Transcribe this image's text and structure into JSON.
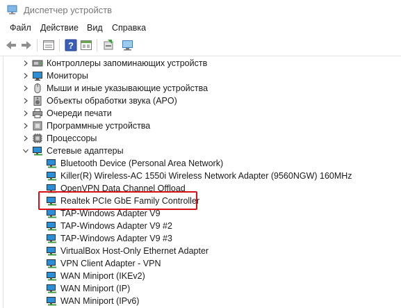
{
  "window": {
    "title": "Диспетчер устройств"
  },
  "menu": [
    {
      "label": "Файл"
    },
    {
      "label": "Действие"
    },
    {
      "label": "Вид"
    },
    {
      "label": "Справка"
    }
  ],
  "toolbar": {
    "buttons": [
      "back-icon",
      "forward-icon",
      "properties-list-icon",
      "help-icon",
      "view-grid-icon",
      "update-driver-icon",
      "scan-hardware-icon"
    ]
  },
  "tree": {
    "categories_top": [
      {
        "label": "Контроллеры запоминающих устройств",
        "icon": "storage-controller-icon",
        "expanded": false
      },
      {
        "label": "Мониторы",
        "icon": "monitor-icon",
        "expanded": false
      },
      {
        "label": "Мыши и иные указывающие устройства",
        "icon": "mouse-icon",
        "expanded": false
      },
      {
        "label": "Объекты обработки звука (APO)",
        "icon": "speaker-icon",
        "expanded": false
      },
      {
        "label": "Очереди печати",
        "icon": "printer-icon",
        "expanded": false
      },
      {
        "label": "Программные устройства",
        "icon": "software-device-icon",
        "expanded": false
      },
      {
        "label": "Процессоры",
        "icon": "processor-icon",
        "expanded": false
      },
      {
        "label": "Сетевые адаптеры",
        "icon": "network-adapter-icon",
        "expanded": true
      }
    ],
    "adapters": [
      {
        "label": "Bluetooth Device (Personal Area Network)"
      },
      {
        "label": "Killer(R) Wireless-AC 1550i Wireless Network Adapter (9560NGW) 160MHz"
      },
      {
        "label": "OpenVPN Data Channel Offload"
      },
      {
        "label": "Realtek PCIe GbE Family Controller",
        "highlighted": true
      },
      {
        "label": "TAP-Windows Adapter V9"
      },
      {
        "label": "TAP-Windows Adapter V9 #2"
      },
      {
        "label": "TAP-Windows Adapter V9 #3"
      },
      {
        "label": "VirtualBox Host-Only Ethernet Adapter"
      },
      {
        "label": "VPN Client Adapter - VPN"
      },
      {
        "label": "WAN Miniport (IKEv2)"
      },
      {
        "label": "WAN Miniport (IP)"
      },
      {
        "label": "WAN Miniport (IPv6)"
      }
    ]
  },
  "colors": {
    "highlight_border": "#d80f16",
    "network_icon_screen": "#2c8fd6"
  }
}
